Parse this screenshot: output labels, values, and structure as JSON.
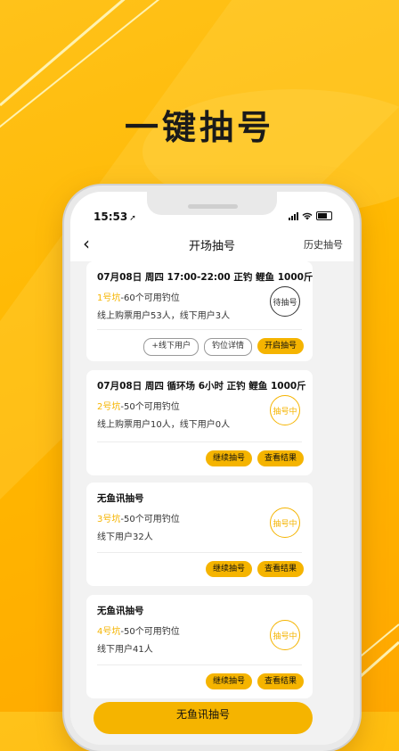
{
  "promo": {
    "headline": "一键抽号"
  },
  "status": {
    "time": "15:53",
    "loc_icon": "➚"
  },
  "nav": {
    "back": "‹",
    "title": "开场抽号",
    "history": "历史抽号"
  },
  "cards": [
    {
      "title": "07月08日 周四 17:00-22:00 正钓 鲤鱼 1000斤",
      "pit": "1号坑",
      "seats": "-60个可用钓位",
      "users": "线上购票用户53人，线下用户3人",
      "seal": "待抽号",
      "buttons": [
        "+线下用户",
        "钓位详情",
        "开启抽号"
      ]
    },
    {
      "title": "07月08日 周四  循环场 6小时 正钓 鲤鱼 1000斤",
      "pit": "2号坑",
      "seats": "-50个可用钓位",
      "users": "线上购票用户10人，线下用户0人",
      "seal": "抽号中",
      "buttons": [
        "继续抽号",
        "查看结果"
      ]
    },
    {
      "title": "无鱼讯抽号",
      "pit": "3号坑",
      "seats": "-50个可用钓位",
      "users": "线下用户32人",
      "seal": "抽号中",
      "buttons": [
        "继续抽号",
        "查看结果"
      ]
    },
    {
      "title": "无鱼讯抽号",
      "pit": "4号坑",
      "seats": "-50个可用钓位",
      "users": "线下用户41人",
      "seal": "抽号中",
      "buttons": [
        "继续抽号",
        "查看结果"
      ]
    }
  ],
  "bottom": {
    "label": "无鱼讯抽号"
  },
  "colors": {
    "brand": "#f5b400",
    "background": "#ffb800"
  }
}
